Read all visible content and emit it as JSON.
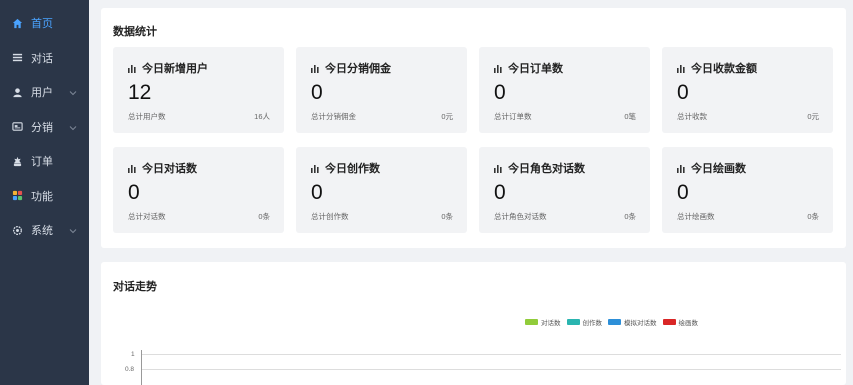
{
  "sidebar": {
    "items": [
      {
        "label": "首页",
        "icon": "home-icon",
        "active": true,
        "expandable": false
      },
      {
        "label": "对话",
        "icon": "menu-lines-icon",
        "active": false,
        "expandable": false
      },
      {
        "label": "用户",
        "icon": "user-icon",
        "active": false,
        "expandable": true
      },
      {
        "label": "分销",
        "icon": "share-icon",
        "active": false,
        "expandable": true
      },
      {
        "label": "订单",
        "icon": "order-icon",
        "active": false,
        "expandable": false
      },
      {
        "label": "功能",
        "icon": "grid-icon",
        "active": false,
        "expandable": false
      },
      {
        "label": "系统",
        "icon": "gear-icon",
        "active": false,
        "expandable": true
      }
    ]
  },
  "stats": {
    "title": "数据统计",
    "cards": [
      {
        "title": "今日新增用户",
        "value": "12",
        "sub_label": "总计用户数",
        "sub_value": "16人"
      },
      {
        "title": "今日分销佣金",
        "value": "0",
        "sub_label": "总计分销佣金",
        "sub_value": "0元"
      },
      {
        "title": "今日订单数",
        "value": "0",
        "sub_label": "总计订单数",
        "sub_value": "0笔"
      },
      {
        "title": "今日收款金额",
        "value": "0",
        "sub_label": "总计收款",
        "sub_value": "0元"
      },
      {
        "title": "今日对话数",
        "value": "0",
        "sub_label": "总计对话数",
        "sub_value": "0条"
      },
      {
        "title": "今日创作数",
        "value": "0",
        "sub_label": "总计创作数",
        "sub_value": "0条"
      },
      {
        "title": "今日角色对话数",
        "value": "0",
        "sub_label": "总计角色对话数",
        "sub_value": "0条"
      },
      {
        "title": "今日绘画数",
        "value": "0",
        "sub_label": "总计绘画数",
        "sub_value": "0条"
      }
    ]
  },
  "trend": {
    "title": "对话走势",
    "legend": [
      {
        "label": "对话数",
        "color": "#91cc3a"
      },
      {
        "label": "创作数",
        "color": "#2ab5b0"
      },
      {
        "label": "模拟对话数",
        "color": "#2d8fd8"
      },
      {
        "label": "绘画数",
        "color": "#d92626"
      }
    ],
    "y_ticks": [
      "1",
      "0.8"
    ]
  },
  "colors": {
    "sidebar_bg": "#2b3648",
    "active": "#4aa3ff",
    "card_bg": "#f2f3f5"
  }
}
